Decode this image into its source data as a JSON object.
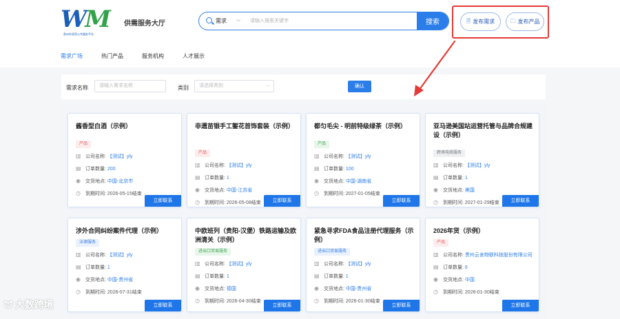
{
  "header": {
    "logo_text": "WM",
    "logo_subtitle": "贵州外经贸公共服务平台",
    "site_title": "供需服务大厅",
    "search": {
      "category": "需求",
      "placeholder": "请输入搜索关键字",
      "button": "搜索"
    },
    "publish_demand": "发布需求",
    "publish_product": "发布产品"
  },
  "nav": {
    "items": [
      "需求广场",
      "热门产品",
      "服务机构",
      "人才展示"
    ],
    "active_index": 0
  },
  "filter": {
    "name_label": "需求名称",
    "name_placeholder": "请输入需求名称",
    "type_label": "类别",
    "type_placeholder": "请选择类别",
    "confirm": "确认"
  },
  "field_labels": {
    "company": "公司名称:",
    "quantity": "订单数量:",
    "place": "交货地点:",
    "deadline": "到期时间:"
  },
  "contact_label": "立即联系",
  "cards": [
    {
      "title": "酱香型白酒（示例）",
      "tag": "产品",
      "company": "【测试】yly",
      "quantity": "200",
      "place": "中国-北京市",
      "deadline": "2026-05-15结束"
    },
    {
      "title": "非遗苗银手工錾花首饰套装（示例）",
      "tag": "产品",
      "company": "【测试】yly",
      "quantity": "1",
      "place": "中国-江苏省",
      "deadline": "2026-05-08结束"
    },
    {
      "title": "都匀毛尖 - 明前特级绿茶（示例）",
      "tag": "产品",
      "company": "【测试】yly",
      "quantity": "100",
      "place": "中国-湖南省",
      "deadline": "2027-01-05结束"
    },
    {
      "title": "亚马逊美国站运营托管与品牌合规建设（示例）",
      "tag": "跨境电商服务",
      "company": "【测试】yly",
      "quantity": "1",
      "place": "美国",
      "deadline": "2027-01-29结束"
    },
    {
      "title": "涉外合同纠纷案件代理（示例）",
      "tag": "法律服务",
      "company": "【测试】yly",
      "quantity": "1",
      "place": "中国-贵州省",
      "deadline": "2026-07-31结束"
    },
    {
      "title": "中欧班列（贵阳-汉堡）铁路运输及欧洲清关（示例）",
      "tag": "进出口贸易服务",
      "company": "【测试】yly",
      "quantity": "1",
      "place": "德国",
      "deadline": "2026-04-30结束"
    },
    {
      "title": "紧急寻求FDA食品注册代理服务（示例）",
      "tag": "进出口贸易服务",
      "company": "【测试】yly",
      "quantity": "1",
      "place": "中国-贵州省",
      "deadline": "2026-01-30结束"
    },
    {
      "title": "2026年货（示例）",
      "tag": "产品",
      "company": "贵州云舍物联科技股份有限公司",
      "quantity": "6",
      "place": "中国",
      "deadline": "2026-01-30结束"
    }
  ],
  "watermark": "大数跨境",
  "colors": {
    "primary": "#2b7de9",
    "highlight": "#e53935",
    "tag_red": "#e95b5b",
    "tag_green": "#3fa655"
  }
}
